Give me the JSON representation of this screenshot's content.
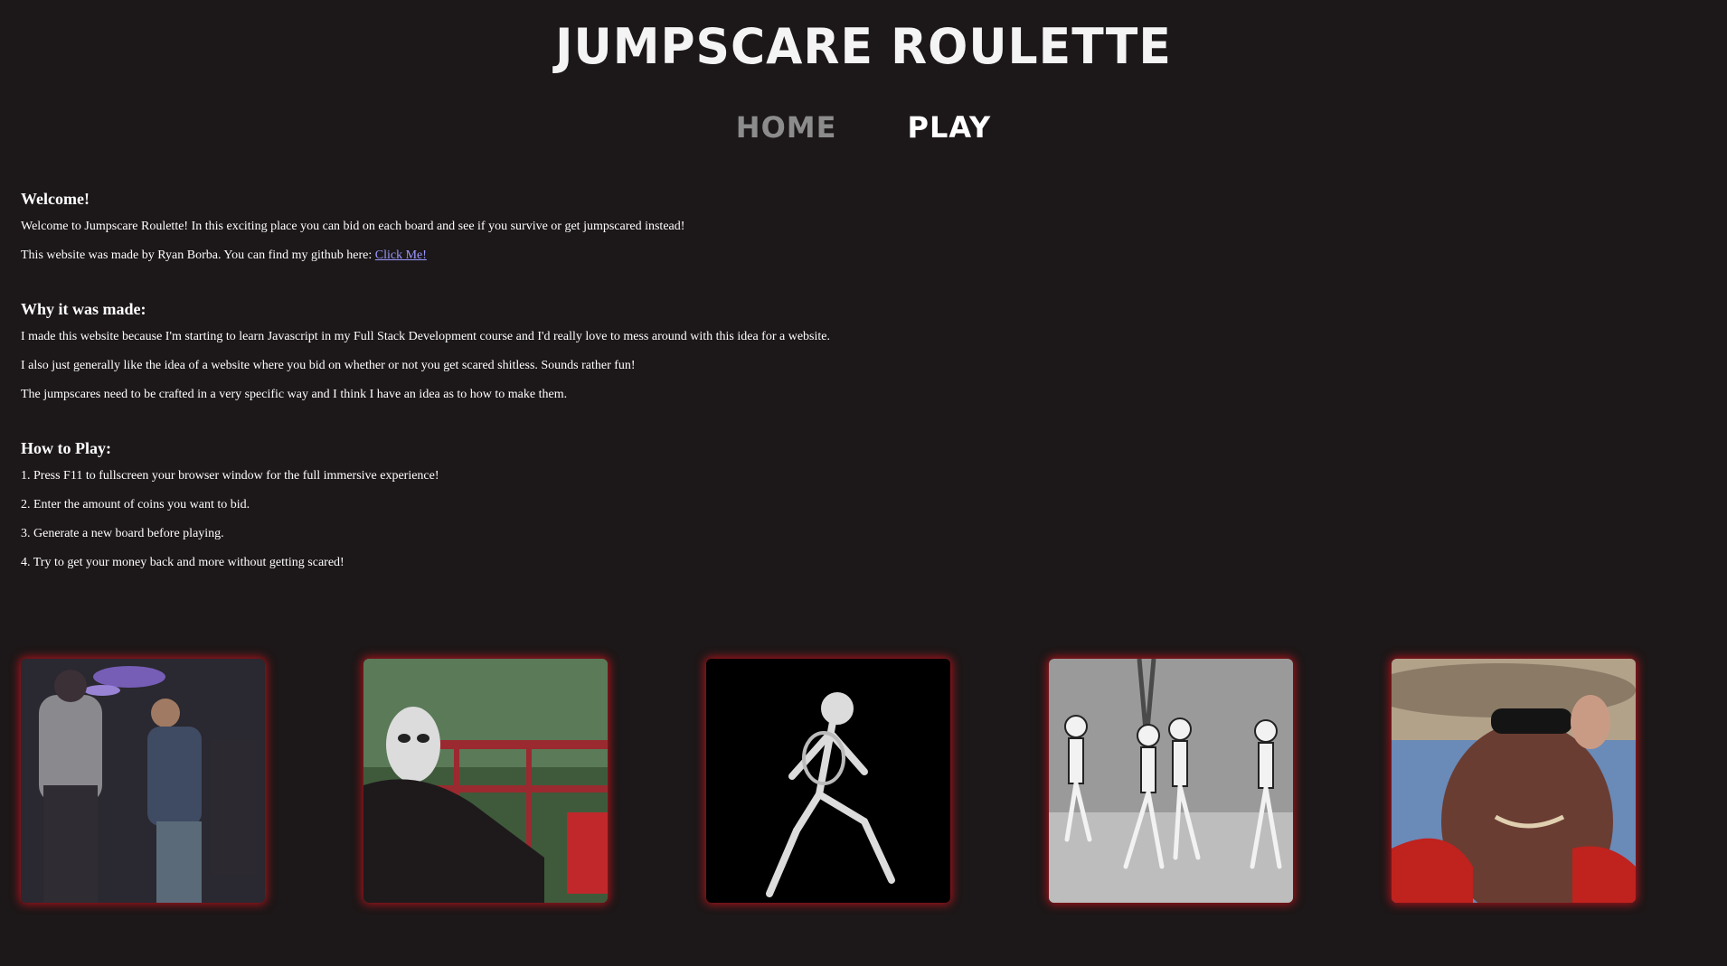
{
  "header": {
    "title": "JUMPSCARE ROULETTE"
  },
  "nav": {
    "home": "HOME",
    "play": "PLAY"
  },
  "welcome": {
    "heading": "Welcome!",
    "line1": "Welcome to Jumpscare Roulette! In this exciting place you can bid on each board and see if you survive or get jumpscared instead!",
    "line2_prefix": "This website was made by Ryan Borba. You can find my github here: ",
    "link_text": "Click Me!"
  },
  "why": {
    "heading": "Why it was made:",
    "lines": [
      "I made this website because I'm starting to learn Javascript in my Full Stack Development course and I'd really love to mess around with this idea for a website.",
      "I also just generally like the idea of a website where you bid on whether or not you get scared shitless. Sounds rather fun!",
      "The jumpscares need to be crafted in a very specific way and I think I have an idea as to how to make them."
    ]
  },
  "how": {
    "heading": "How to Play:",
    "steps": [
      "1. Press F11 to fullscreen your browser window for the full immersive experience!",
      "2. Enter the amount of coins you want to bid.",
      "3. Generate a new board before playing.",
      "4. Try to get your money back and more without getting scared!"
    ]
  },
  "gallery": [
    {
      "name": "dancing-people-image"
    },
    {
      "name": "masked-figure-image"
    },
    {
      "name": "skeleton-image"
    },
    {
      "name": "dancing-skeletons-image"
    },
    {
      "name": "hat-man-image"
    }
  ],
  "colors": {
    "background": "#1c1718",
    "glow": "#a8141b",
    "link": "#9a9aff",
    "nav_inactive": "#8c8c8c"
  }
}
